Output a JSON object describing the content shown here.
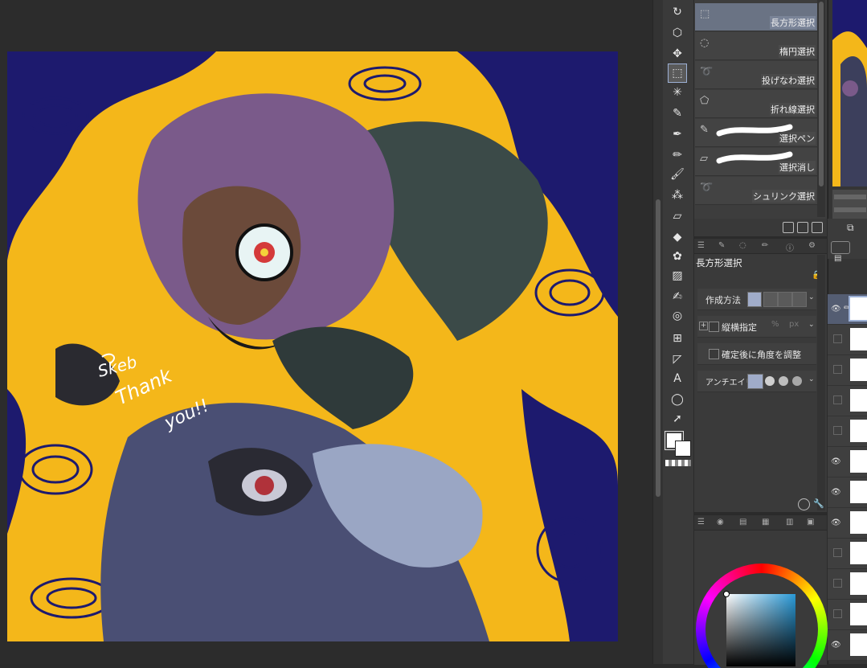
{
  "canvas": {
    "signature_line1": "Skeb",
    "signature_line2": "Thank",
    "signature_line3": "you!!"
  },
  "tools": [
    {
      "name": "move-icon"
    },
    {
      "name": "object-icon"
    },
    {
      "name": "move-layer-icon"
    },
    {
      "name": "selection-icon",
      "active": true
    },
    {
      "name": "auto-select-icon"
    },
    {
      "name": "eyedropper-icon"
    },
    {
      "name": "pen-icon"
    },
    {
      "name": "pencil-icon"
    },
    {
      "name": "brush-icon"
    },
    {
      "name": "airbrush-icon"
    },
    {
      "name": "eraser-icon"
    },
    {
      "name": "fill-icon"
    },
    {
      "name": "decoration-icon"
    },
    {
      "name": "gradient-icon"
    },
    {
      "name": "figure-icon"
    },
    {
      "name": "blend-icon"
    },
    {
      "name": "frame-icon"
    },
    {
      "name": "ruler-icon"
    },
    {
      "name": "text-icon"
    },
    {
      "name": "balloon-icon"
    },
    {
      "name": "correct-line-icon"
    }
  ],
  "subtools": [
    {
      "label": "長方形選択",
      "active": true
    },
    {
      "label": "楕円選択"
    },
    {
      "label": "投げなわ選択"
    },
    {
      "label": "折れ線選択"
    },
    {
      "label": "選択ペン"
    },
    {
      "label": "選択消し"
    },
    {
      "label": "シュリンク選択"
    }
  ],
  "tool_property": {
    "title": "長方形選択",
    "creation_method_label": "作成方法",
    "aspect_label": "縦横指定",
    "adjust_angle_label": "確定後に角度を調整",
    "antialias_label": "アンチエイリ"
  },
  "colors": {
    "accent": "#9db1d6",
    "canvas_bg": "#f4b71a",
    "sky": "#1d1a6e",
    "main_color": "#ffffff",
    "sub_color": "#ffffff"
  }
}
